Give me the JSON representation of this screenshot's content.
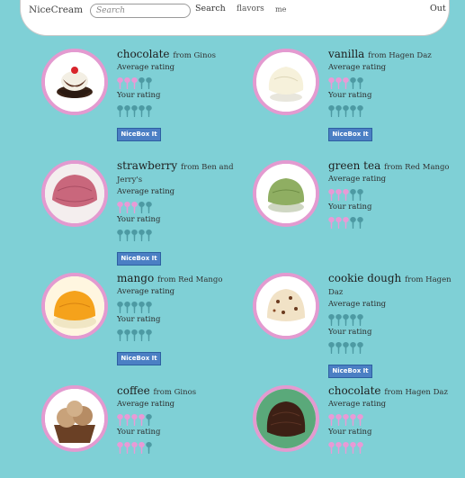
{
  "header": {
    "brand": "NiceCream",
    "search_placeholder": "Search",
    "search_label": "Search",
    "flavors_label": "flavors",
    "me_label": "me",
    "out_label": "Out"
  },
  "labels": {
    "average_rating": "Average rating",
    "your_rating": "Your rating",
    "nicebox_button": "NiceBox It"
  },
  "items": [
    {
      "name": "chocolate",
      "source": "from Ginos",
      "avg": 3,
      "yours": 0,
      "image": "chocolate-sundae"
    },
    {
      "name": "vanilla",
      "source": "from Hagen Daz",
      "avg": 3,
      "yours": 0,
      "image": "vanilla-scoop"
    },
    {
      "name": "strawberry",
      "source": "from Ben and Jerry's",
      "avg": 3,
      "yours": 0,
      "image": "strawberry-scoop"
    },
    {
      "name": "green tea",
      "source": "from Red Mango",
      "avg": 3,
      "yours": 3,
      "image": "green-tea-scoop"
    },
    {
      "name": "mango",
      "source": "from Red Mango",
      "avg": 0,
      "yours": 0,
      "image": "mango-scoop"
    },
    {
      "name": "cookie dough",
      "source": "from Hagen Daz",
      "avg": 0,
      "yours": 0,
      "image": "cookie-dough-scoop"
    },
    {
      "name": "coffee",
      "source": "from Ginos",
      "avg": 4,
      "yours": 4,
      "image": "coffee-scoops"
    },
    {
      "name": "chocolate",
      "source": "from Hagen Daz",
      "avg": 5,
      "yours": 5,
      "image": "chocolate-scoop"
    }
  ]
}
